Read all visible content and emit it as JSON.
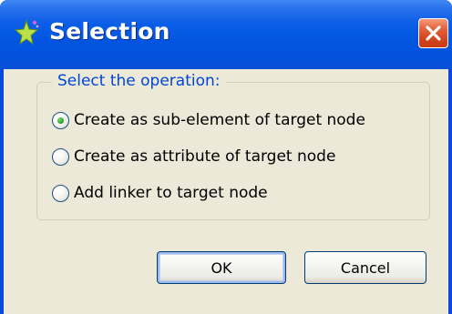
{
  "window": {
    "title": "Selection",
    "app_icon": "star-sparkle-icon",
    "close_icon": "close-x-icon"
  },
  "group": {
    "caption": "Select the operation:",
    "options": [
      {
        "label": "Create as sub-element of target node",
        "selected": true
      },
      {
        "label": "Create as attribute of target node",
        "selected": false
      },
      {
        "label": "Add linker to target node",
        "selected": false
      }
    ]
  },
  "buttons": {
    "ok": "OK",
    "cancel": "Cancel"
  },
  "colors": {
    "titlebar": "#0355e0",
    "dialog_bg": "#ece9d8",
    "caption_text": "#0046d5",
    "close_button": "#d3451f",
    "radio_selected": "#2fa22f"
  }
}
